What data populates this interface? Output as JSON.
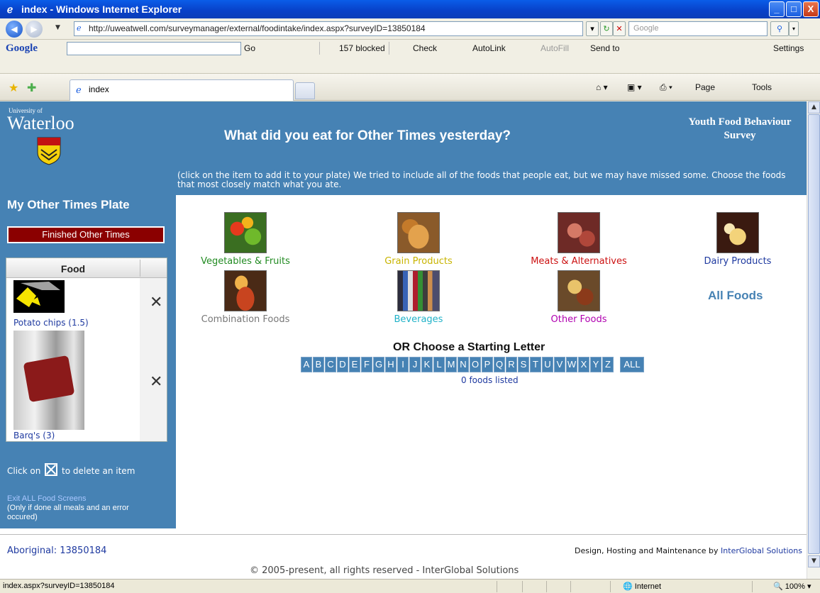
{
  "window": {
    "title": "index - Windows Internet Explorer",
    "controls": [
      "_",
      "□",
      "X"
    ]
  },
  "address": {
    "url": "http://uweatwell.com/surveymanager/external/foodintake/index.aspx?surveyID=13850184",
    "search_placeholder": "Google"
  },
  "google_toolbar": {
    "logo": "Google",
    "go": "Go",
    "blocked": "157 blocked",
    "check": "Check",
    "autolink": "AutoLink",
    "autofill": "AutoFill",
    "send_to": "Send to",
    "settings": "Settings"
  },
  "tabs": [
    {
      "label": "index"
    }
  ],
  "command_bar": {
    "page": "Page",
    "tools": "Tools"
  },
  "page": {
    "university_small": "University of",
    "university_big": "Waterloo",
    "title": "What did you eat for Other Times yesterday?",
    "survey_name": "Youth Food Behaviour Survey",
    "instructions": "(click on the item to add it to your plate) We tried to include all of the foods that people eat, but we may have missed some. Choose the foods that most closely match what you ate."
  },
  "plate": {
    "title": "My Other Times Plate",
    "finished_button": "Finished Other Times",
    "column_header": "Food",
    "items": [
      {
        "name": "Potato chips (1.5)",
        "delete": "✕"
      },
      {
        "name": "Barq's (3)",
        "delete": "✕"
      }
    ],
    "delete_hint_before": "Click on",
    "delete_hint_after": "to delete an item",
    "exit_link": "Exit ALL Food Screens",
    "exit_note": "(Only if done all meals and an error occured)"
  },
  "categories": [
    {
      "label": "Vegetables & Fruits",
      "color": "#228b22"
    },
    {
      "label": "Grain Products",
      "color": "#c8b400"
    },
    {
      "label": "Meats & Alternatives",
      "color": "#cc1111"
    },
    {
      "label": "Dairy Products",
      "color": "#1f3aa0"
    },
    {
      "label": "Combination Foods",
      "color": "#777777"
    },
    {
      "label": "Beverages",
      "color": "#20b2c8"
    },
    {
      "label": "Other Foods",
      "color": "#b000b0"
    }
  ],
  "all_foods": "All Foods",
  "letter_picker": {
    "heading": "OR Choose a Starting Letter",
    "letters": [
      "A",
      "B",
      "C",
      "D",
      "E",
      "F",
      "G",
      "H",
      "I",
      "J",
      "K",
      "L",
      "M",
      "N",
      "O",
      "P",
      "Q",
      "R",
      "S",
      "T",
      "U",
      "V",
      "W",
      "X",
      "Y",
      "Z"
    ],
    "all": "ALL",
    "foods_listed": "0 foods listed"
  },
  "footer": {
    "aboriginal": "Aboriginal: 13850184",
    "design_prefix": "Design, Hosting and Maintenance by",
    "design_link": "InterGlobal Solutions",
    "copyright": "© 2005-present, all rights reserved - InterGlobal Solutions"
  },
  "statusbar": {
    "url": "index.aspx?surveyID=13850184",
    "zone": "Internet",
    "zoom": "100%"
  }
}
